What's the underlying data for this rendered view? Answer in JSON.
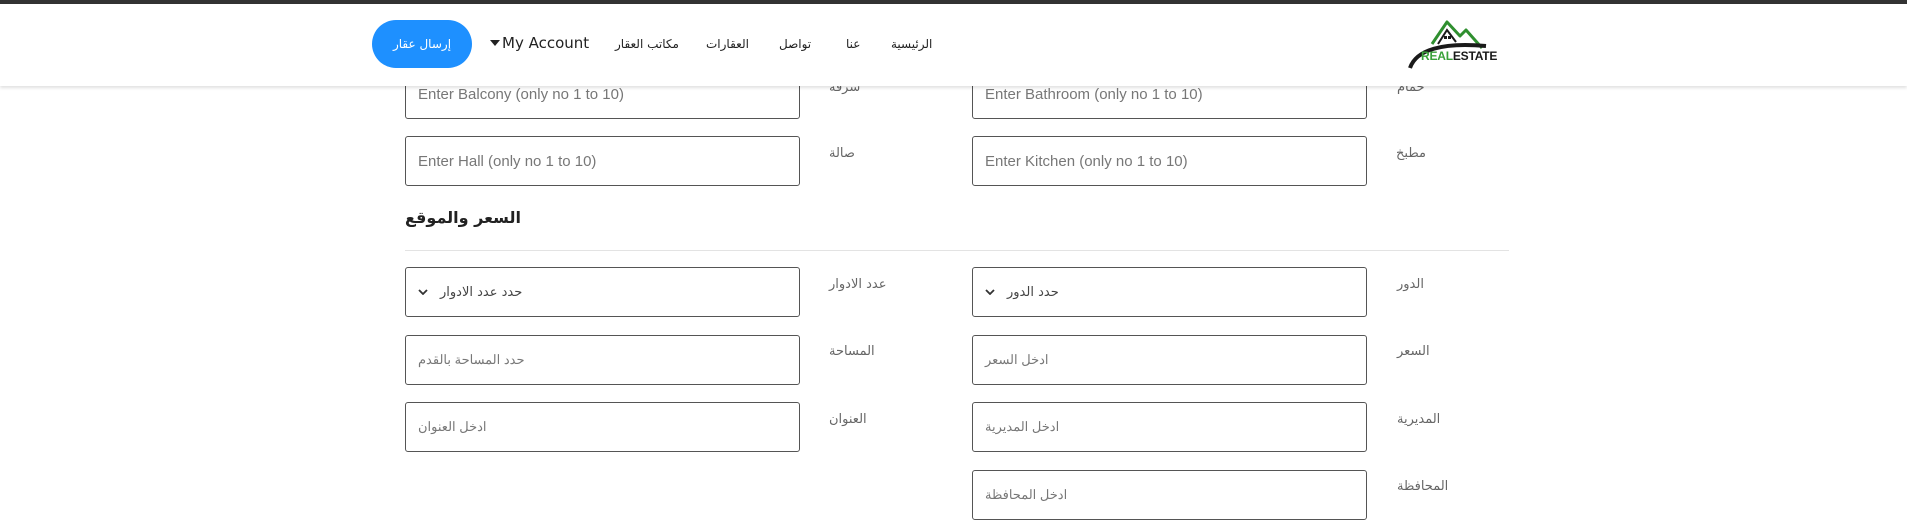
{
  "navbar": {
    "submit_button": "إرسال عقار",
    "account_label": "My Account",
    "links": [
      "مكاتب العقار",
      "العقارات",
      "تواصل",
      "عنا",
      "الرئيسية"
    ],
    "logo": {
      "part1": "REAL",
      "part2": "ESTATE"
    }
  },
  "form": {
    "balcony": {
      "label": "شرفة",
      "placeholder": "Enter Balcony  (only no 1 to 10)"
    },
    "bathroom": {
      "label": "حمام",
      "placeholder": "Enter Bathroom (only no 1 to 10)"
    },
    "hall": {
      "label": "صالة",
      "placeholder": "Enter Hall  (only no 1 to 10)"
    },
    "kitchen": {
      "label": "مطبخ",
      "placeholder": "Enter Kitchen (only no 1 to 10)"
    },
    "section_title": "السعر والموقع",
    "floors_count": {
      "label": "عدد الادوار",
      "selected": "حدد عدد الادوار"
    },
    "floor": {
      "label": "الدور",
      "selected": "حدد الدور"
    },
    "area": {
      "label": "المساحة",
      "placeholder": "حدد المساحة بالقدم"
    },
    "price": {
      "label": "السعر",
      "placeholder": "ادخل السعر"
    },
    "address": {
      "label": "العنوان",
      "placeholder": "ادخل العنوان"
    },
    "directorate": {
      "label": "المديرية",
      "placeholder": "ادخل المديرية"
    },
    "governorate": {
      "label": "المحافظة",
      "placeholder": "ادخل المحافظة"
    }
  },
  "colors": {
    "accent": "#1e90ff",
    "logo_green": "#3aa23a"
  }
}
